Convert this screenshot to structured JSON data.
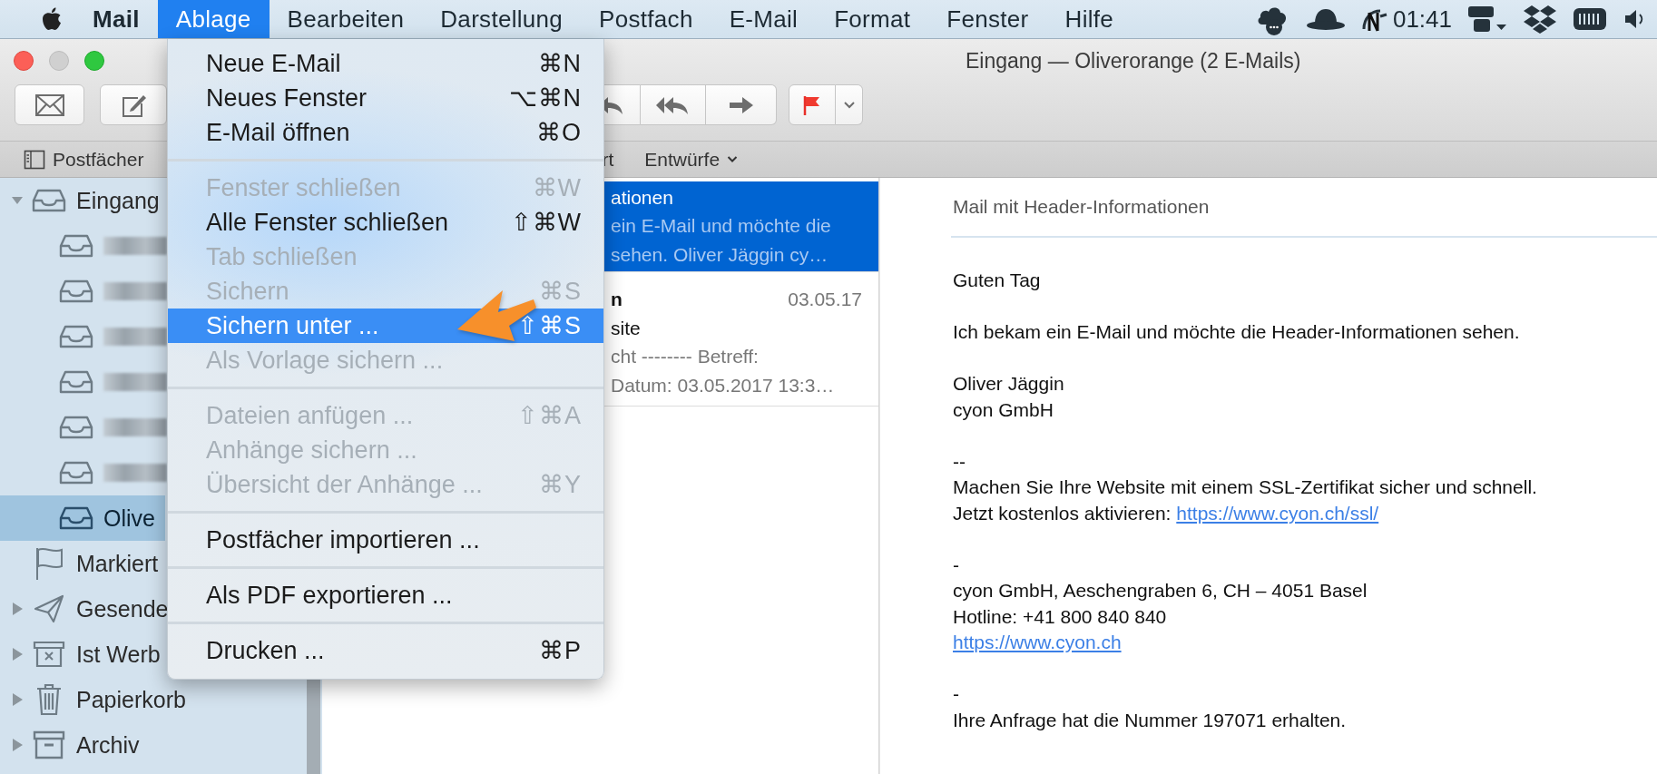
{
  "menu_bar": {
    "items": [
      {
        "label": "Mail",
        "kind": "app",
        "selected": false
      },
      {
        "label": "Ablage",
        "kind": "menu",
        "selected": true
      },
      {
        "label": "Bearbeiten",
        "kind": "menu",
        "selected": false
      },
      {
        "label": "Darstellung",
        "kind": "menu",
        "selected": false
      },
      {
        "label": "Postfach",
        "kind": "menu",
        "selected": false
      },
      {
        "label": "E-Mail",
        "kind": "menu",
        "selected": false
      },
      {
        "label": "Format",
        "kind": "menu",
        "selected": false
      },
      {
        "label": "Fenster",
        "kind": "menu",
        "selected": false
      },
      {
        "label": "Hilfe",
        "kind": "menu",
        "selected": false
      }
    ],
    "clock": "01:41"
  },
  "window": {
    "title": "Eingang — Oliverorange (2 E-Mails)"
  },
  "favorites_bar": {
    "items": [
      {
        "label": "Postfächer",
        "kind": "sidebar-toggle"
      },
      {
        "label": "rt",
        "kind": "plain"
      },
      {
        "label": "Entwürfe",
        "kind": "dropdown"
      }
    ]
  },
  "sidebar": {
    "items": [
      {
        "label": "Eingang",
        "kind": "inbox",
        "expanded": true,
        "selected": false,
        "children": [
          {
            "kind": "inbox",
            "redacted": true,
            "selected": false
          },
          {
            "kind": "inbox",
            "redacted": true,
            "selected": false
          },
          {
            "kind": "inbox",
            "redacted": true,
            "selected": false
          },
          {
            "kind": "inbox",
            "redacted": true,
            "selected": false
          },
          {
            "kind": "inbox",
            "redacted": true,
            "selected": false
          },
          {
            "kind": "inbox",
            "redacted": true,
            "selected": false
          },
          {
            "label": "Olive",
            "kind": "inbox",
            "selected": true
          }
        ]
      },
      {
        "label": "Markiert",
        "kind": "flag",
        "selected": false
      },
      {
        "label": "Gesende",
        "kind": "sent",
        "expanded": false,
        "selected": false
      },
      {
        "label": "Ist Werb",
        "kind": "junk",
        "expanded": false,
        "selected": false
      },
      {
        "label": "Papierkorb",
        "kind": "trash",
        "expanded": false,
        "selected": false
      },
      {
        "label": "Archiv",
        "kind": "archive",
        "expanded": false,
        "selected": false
      }
    ]
  },
  "message_list": {
    "messages": [
      {
        "selected": true,
        "subject": "ationen",
        "preview": [
          "ein E-Mail und möchte die",
          "sehen. Oliver Jäggin cy…"
        ]
      },
      {
        "selected": false,
        "sender": "n",
        "date": "03.05.17",
        "subject": "site",
        "preview": [
          "cht -------- Betreff:",
          "Datum: 03.05.2017 13:3…"
        ]
      }
    ]
  },
  "message_view": {
    "subject": "Mail mit Header-Informationen",
    "body": [
      {
        "lines": [
          {
            "text": "Guten Tag"
          }
        ]
      },
      {
        "lines": [
          {
            "text": "Ich bekam ein E-Mail und möchte die Header-Informationen sehen."
          }
        ]
      },
      {
        "lines": [
          {
            "text": "Oliver Jäggin"
          },
          {
            "text": "cyon GmbH"
          }
        ]
      },
      {
        "lines": [
          {
            "text": "--"
          },
          {
            "text": "Machen Sie Ihre Website mit einem SSL-Zertifikat sicher und schnell."
          },
          {
            "text": "Jetzt kostenlos aktivieren:",
            "link": "https://www.cyon.ch/ssl/"
          }
        ]
      },
      {
        "lines": [
          {
            "text": "-"
          },
          {
            "text": "cyon GmbH, Aeschengraben 6, CH – 4051 Basel"
          },
          {
            "text": "Hotline: +41 800 840 840"
          },
          {
            "link": "https://www.cyon.ch"
          }
        ]
      },
      {
        "lines": [
          {
            "text": "-"
          },
          {
            "text": "Ihre Anfrage hat die Nummer 197071 erhalten."
          }
        ]
      }
    ]
  },
  "file_menu": {
    "items": [
      {
        "kind": "item",
        "label": "Neue E-Mail",
        "shortcut": "⌘N",
        "disabled": false,
        "selected": false
      },
      {
        "kind": "item",
        "label": "Neues Fenster",
        "shortcut": "⌥⌘N",
        "disabled": false,
        "selected": false
      },
      {
        "kind": "item",
        "label": "E-Mail öffnen",
        "shortcut": "⌘O",
        "disabled": false,
        "selected": false
      },
      {
        "kind": "separator"
      },
      {
        "kind": "item",
        "label": "Fenster schließen",
        "shortcut": "⌘W",
        "disabled": true,
        "selected": false
      },
      {
        "kind": "item",
        "label": "Alle Fenster schließen",
        "shortcut": "⇧⌘W",
        "disabled": false,
        "selected": false
      },
      {
        "kind": "item",
        "label": "Tab schließen",
        "disabled": true,
        "selected": false
      },
      {
        "kind": "item",
        "label": "Sichern",
        "shortcut": "⌘S",
        "disabled": true,
        "selected": false
      },
      {
        "kind": "item",
        "label": "Sichern unter ...",
        "shortcut": "⇧⌘S",
        "disabled": false,
        "selected": true
      },
      {
        "kind": "item",
        "label": "Als Vorlage sichern ...",
        "disabled": true,
        "selected": false
      },
      {
        "kind": "separator"
      },
      {
        "kind": "item",
        "label": "Dateien anfügen ...",
        "shortcut": "⇧⌘A",
        "disabled": true,
        "selected": false
      },
      {
        "kind": "item",
        "label": "Anhänge sichern ...",
        "disabled": true,
        "selected": false
      },
      {
        "kind": "item",
        "label": "Übersicht der Anhänge ...",
        "shortcut": "⌘Y",
        "disabled": true,
        "selected": false
      },
      {
        "kind": "separator"
      },
      {
        "kind": "item",
        "label": "Postfächer importieren ...",
        "disabled": false,
        "selected": false
      },
      {
        "kind": "separator"
      },
      {
        "kind": "item",
        "label": "Als PDF exportieren ...",
        "disabled": false,
        "selected": false
      },
      {
        "kind": "separator"
      },
      {
        "kind": "item",
        "label": "Drucken ...",
        "shortcut": "⌘P",
        "disabled": false,
        "selected": false
      }
    ]
  }
}
